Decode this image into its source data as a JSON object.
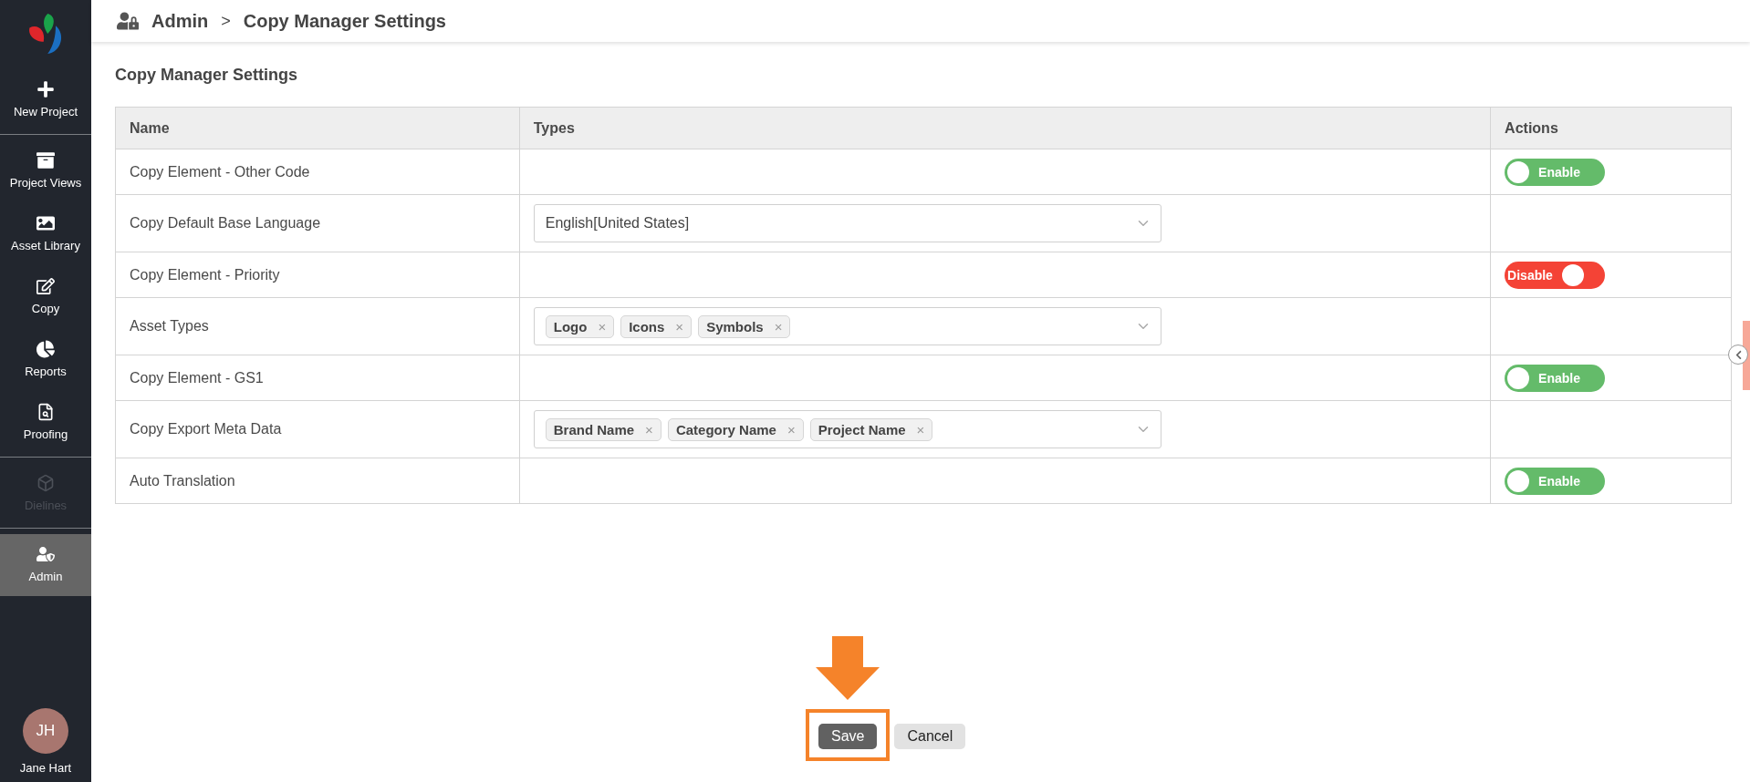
{
  "sidebar": {
    "groups": [
      [
        {
          "label": "New Project",
          "selected": false,
          "disabled": false
        }
      ],
      [
        {
          "label": "Project Views",
          "selected": false,
          "disabled": false
        },
        {
          "label": "Asset Library",
          "selected": false,
          "disabled": false
        },
        {
          "label": "Copy",
          "selected": false,
          "disabled": false
        },
        {
          "label": "Reports",
          "selected": false,
          "disabled": false
        },
        {
          "label": "Proofing",
          "selected": false,
          "disabled": false
        }
      ],
      [
        {
          "label": "Dielines",
          "selected": false,
          "disabled": true
        }
      ],
      [
        {
          "label": "Admin",
          "selected": true,
          "disabled": false
        }
      ]
    ],
    "user": {
      "initials": "JH",
      "name": "Jane Hart"
    }
  },
  "breadcrumb": [
    "Admin",
    "Copy Manager Settings"
  ],
  "breadcrumb_separator": ">",
  "page_title": "Copy Manager Settings",
  "table": {
    "columns": [
      "Name",
      "Types",
      "Actions"
    ],
    "rows": [
      {
        "name": "Copy Element - Other Code",
        "types": {
          "kind": "none"
        },
        "action": {
          "kind": "toggle",
          "on": true,
          "label": "Enable"
        }
      },
      {
        "name": "Copy Default Base Language",
        "types": {
          "kind": "select",
          "value": "English[United States]"
        },
        "action": {
          "kind": "none"
        }
      },
      {
        "name": "Copy Element - Priority",
        "types": {
          "kind": "none"
        },
        "action": {
          "kind": "toggle",
          "on": false,
          "label": "Disable"
        }
      },
      {
        "name": "Asset Types",
        "types": {
          "kind": "tags",
          "tags": [
            "Logo",
            "Icons",
            "Symbols"
          ]
        },
        "action": {
          "kind": "none"
        }
      },
      {
        "name": "Copy Element - GS1",
        "types": {
          "kind": "none"
        },
        "action": {
          "kind": "toggle",
          "on": true,
          "label": "Enable"
        }
      },
      {
        "name": "Copy Export Meta Data",
        "types": {
          "kind": "tags",
          "tags": [
            "Brand Name",
            "Category Name",
            "Project Name"
          ]
        },
        "action": {
          "kind": "none"
        }
      },
      {
        "name": "Auto Translation",
        "types": {
          "kind": "none"
        },
        "action": {
          "kind": "toggle",
          "on": true,
          "label": "Enable"
        }
      }
    ]
  },
  "tag_remove": "×",
  "buttons": [
    {
      "label": "Save",
      "kind": "primary",
      "highlighted": true
    },
    {
      "label": "Cancel",
      "kind": "secondary",
      "highlighted": false
    }
  ]
}
